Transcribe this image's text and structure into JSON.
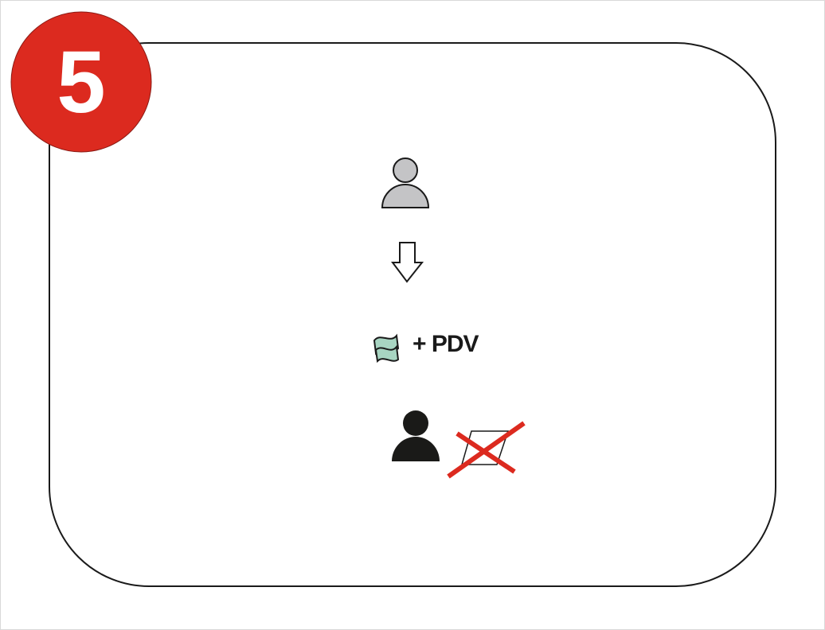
{
  "step_badge": {
    "number": "5",
    "color": "#dc2a1f"
  },
  "formula": {
    "icon": "money-icon",
    "text": "+ PDV",
    "icon_color": "#a8d5c2"
  },
  "icons": {
    "top_person": "person-icon-gray",
    "arrow": "arrow-down-icon",
    "bottom_person": "person-icon-black",
    "crossed_item": "crossed-out-parallelogram-icon"
  },
  "colors": {
    "person_gray": "#c4c4c6",
    "person_black": "#1a1a18",
    "cross": "#dc2a1f"
  }
}
